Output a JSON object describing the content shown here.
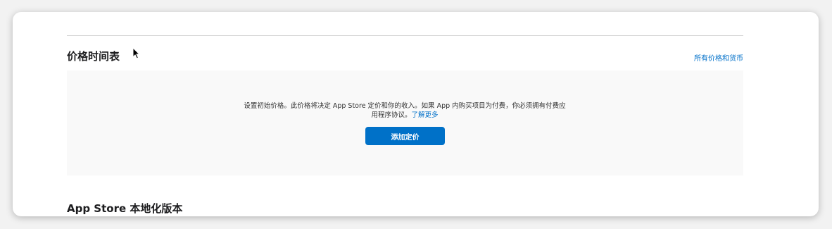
{
  "pricing_section": {
    "title": "价格时间表",
    "all_prices_link": "所有价格和货币",
    "empty_state": {
      "message": "设置初始价格。此价格将决定 App Store 定价和你的收入。如果 App 内购买项目为付费，你必须拥有付费应用程序协议。",
      "learn_more_link": "了解更多",
      "add_button_label": "添加定价"
    }
  },
  "localization_section": {
    "title": "App Store 本地化版本"
  },
  "icons": {
    "cursor": "mouse-pointer-icon"
  },
  "colors": {
    "accent": "#0071c8",
    "link": "#0070c9",
    "panel_background": "#f9f9f9"
  }
}
